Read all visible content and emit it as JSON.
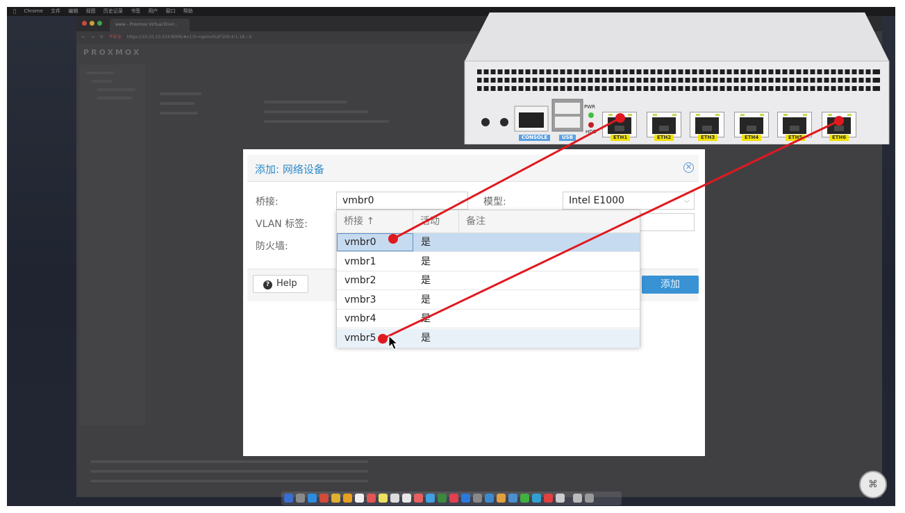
{
  "menubar": {
    "items": [
      "Chrome",
      "文件",
      "编辑",
      "视图",
      "历史记录",
      "书签",
      "用户",
      "窗口",
      "帮助"
    ]
  },
  "browser": {
    "tab_title": "www - Proxmox Virtual Envir...",
    "insecure_label": "不安全",
    "url": "https://10.10.10.254:8006/#v1:0:=qemu%2F100:4:1:18:::3:"
  },
  "pve": {
    "logo": "PROXMOX"
  },
  "device": {
    "console_label": "CONSOLE",
    "usb_label": "USB",
    "pwr_label": "PWR",
    "hdd_label": "HDD",
    "ports": [
      "ETH1",
      "ETH2",
      "ETH3",
      "ETH4",
      "ETH5",
      "ETH6"
    ],
    "label_color": "#f2e200"
  },
  "dialog": {
    "title": "添加: 网络设备",
    "bridge_label": "桥接:",
    "bridge_value": "vmbr0",
    "vlan_label": "VLAN 标签:",
    "firewall_label": "防火墙:",
    "model_label": "模型:",
    "model_value": "Intel E1000",
    "help_label": "Help",
    "add_label": "添加"
  },
  "dropdown": {
    "columns": [
      "桥接 ↑",
      "活动",
      "备注"
    ],
    "rows": [
      {
        "bridge": "vmbr0",
        "active": "是"
      },
      {
        "bridge": "vmbr1",
        "active": "是"
      },
      {
        "bridge": "vmbr2",
        "active": "是"
      },
      {
        "bridge": "vmbr3",
        "active": "是"
      },
      {
        "bridge": "vmbr4",
        "active": "是"
      },
      {
        "bridge": "vmbr5",
        "active": "是"
      }
    ],
    "selected": "vmbr0"
  },
  "colors": {
    "accent": "#2e8bc9",
    "annotation_red": "#e0191f",
    "selected_row": "#c6dbf0",
    "add_button": "#3892d4"
  }
}
